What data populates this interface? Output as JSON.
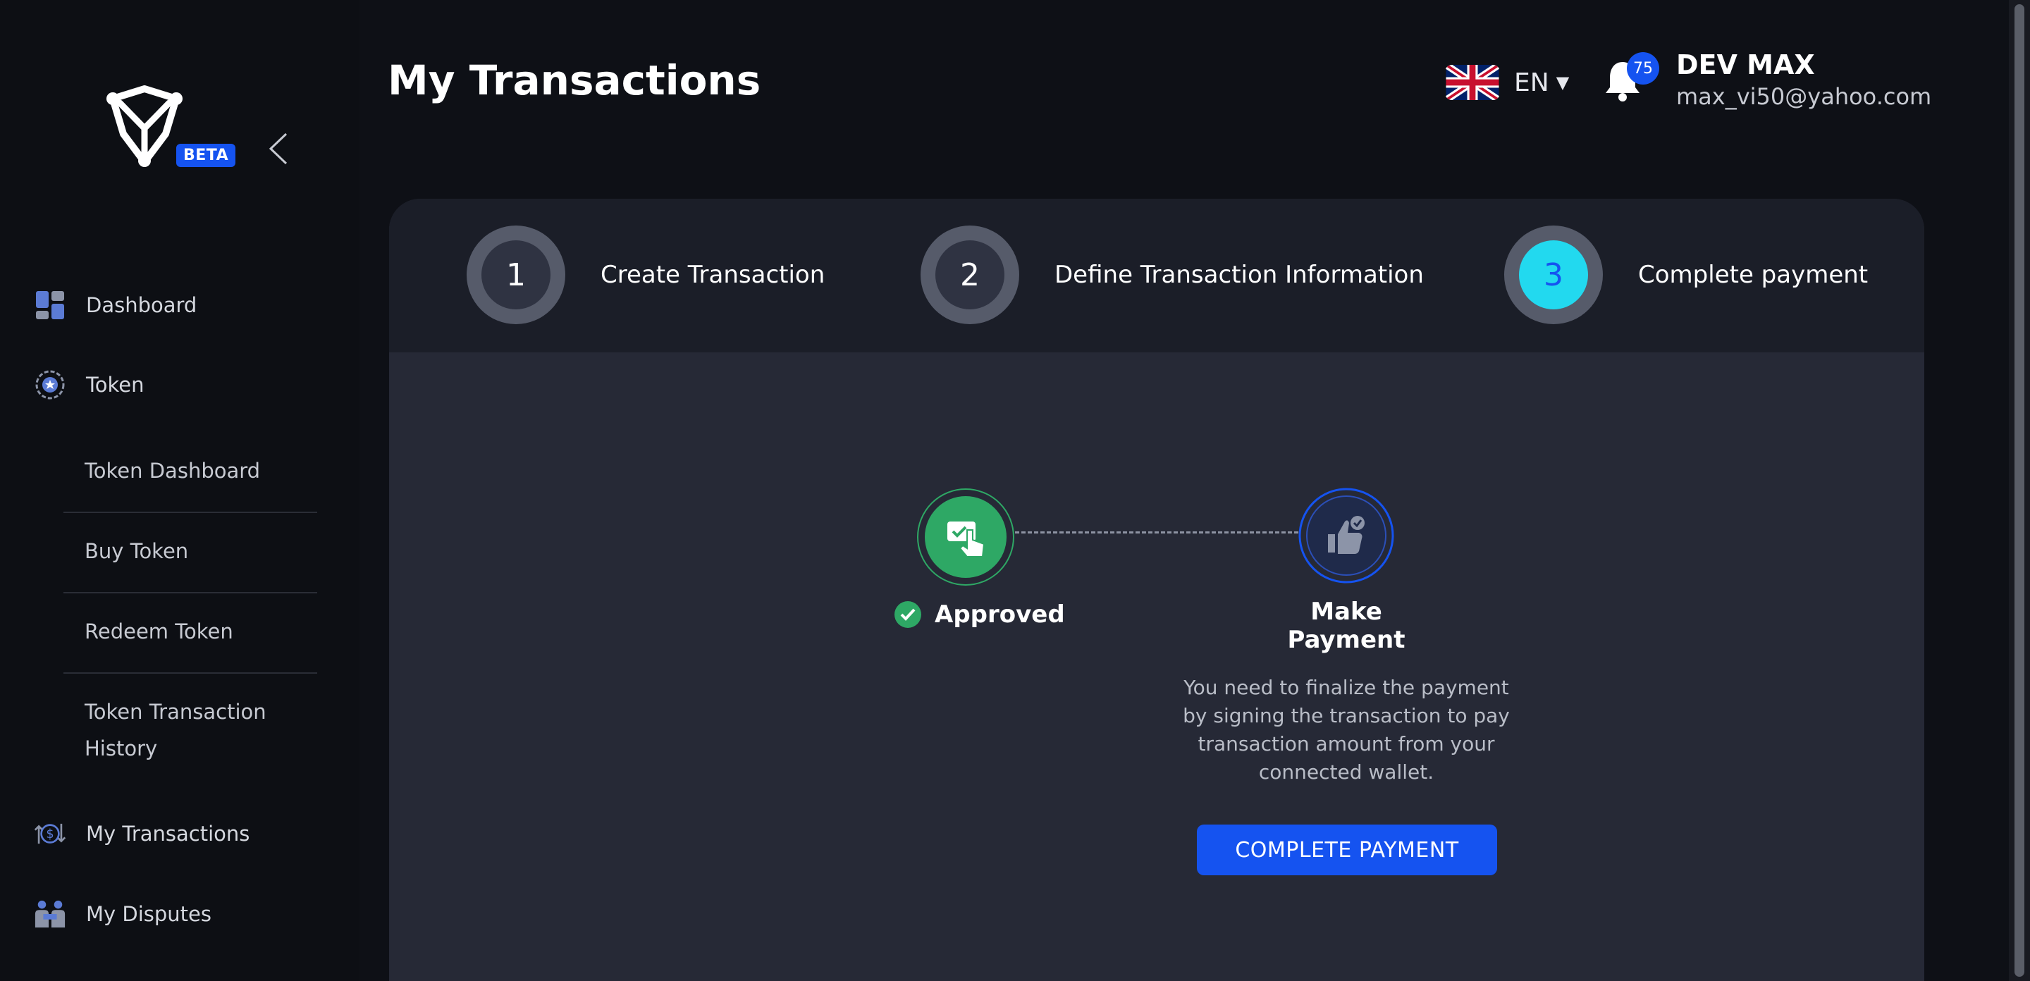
{
  "app": {
    "beta_label": "BETA"
  },
  "sidebar": {
    "items": [
      {
        "label": "Dashboard",
        "icon": "dashboard-icon"
      },
      {
        "label": "Token",
        "icon": "token-icon"
      },
      {
        "label": "My Transactions",
        "icon": "transactions-icon"
      },
      {
        "label": "My Disputes",
        "icon": "disputes-icon"
      }
    ],
    "token_submenu": [
      "Token Dashboard",
      "Buy Token",
      "Redeem Token",
      "Token Transaction",
      "History"
    ]
  },
  "header": {
    "title": "My Transactions",
    "language": "EN",
    "notification_count": "75",
    "user_name": "DEV MAX",
    "user_email": "max_vi50@yahoo.com"
  },
  "stepper": {
    "steps": [
      {
        "number": "1",
        "label": "Create Transaction"
      },
      {
        "number": "2",
        "label": "Define Transaction Information"
      },
      {
        "number": "3",
        "label": "Complete payment",
        "active": true
      }
    ]
  },
  "flow": {
    "approved_label": "Approved",
    "make_payment_label": "Make Payment",
    "description": "You need to finalize the payment by signing the transaction to pay transaction amount from your connected wallet.",
    "button_label": "COMPLETE PAYMENT"
  },
  "colors": {
    "accent": "#1553f0",
    "active_step": "#22d9ef",
    "success": "#2ea865",
    "background": "#0e1016",
    "card": "#262936"
  }
}
